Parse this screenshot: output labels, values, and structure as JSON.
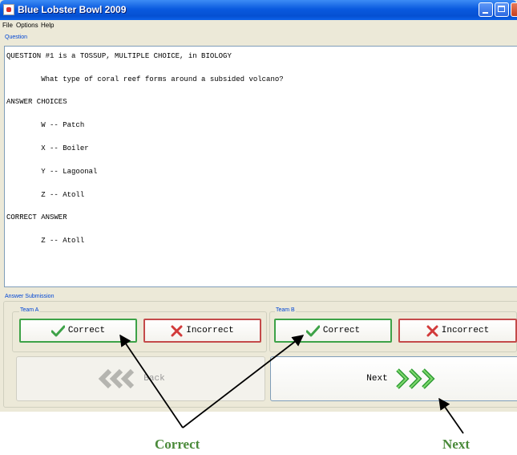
{
  "window": {
    "title": "Blue Lobster Bowl 2009"
  },
  "menu": [
    "File",
    "Options",
    "Help"
  ],
  "question_group": "Question",
  "question_lines": [
    "QUESTION #1 is a TOSSUP, MULTIPLE CHOICE, in BIOLOGY",
    "        What type of coral reef forms around a subsided volcano?",
    "ANSWER CHOICES",
    "        W -- Patch",
    "        X -- Boiler",
    "        Y -- Lagoonal",
    "        Z -- Atoll",
    "CORRECT ANSWER",
    "        Z -- Atoll"
  ],
  "answer_submission": {
    "label": "Answer Submission",
    "team_a": {
      "label": "Team A",
      "correct": "Correct",
      "incorrect": "Incorrect"
    },
    "team_b": {
      "label": "Team B",
      "correct": "Correct",
      "incorrect": "Incorrect"
    }
  },
  "nav": {
    "back": "Back",
    "next": "Next"
  },
  "annotations": {
    "correct": "Correct",
    "next": "Next"
  },
  "colors": {
    "correct_green": "#3da247",
    "incorrect_red": "#c44a4a",
    "annotation_green": "#4a8a3a",
    "label_blue": "#0046d5"
  },
  "icons": {
    "check": "check-icon",
    "cross": "cross-icon",
    "back": "back-chevrons-icon",
    "next": "next-chevrons-icon"
  }
}
